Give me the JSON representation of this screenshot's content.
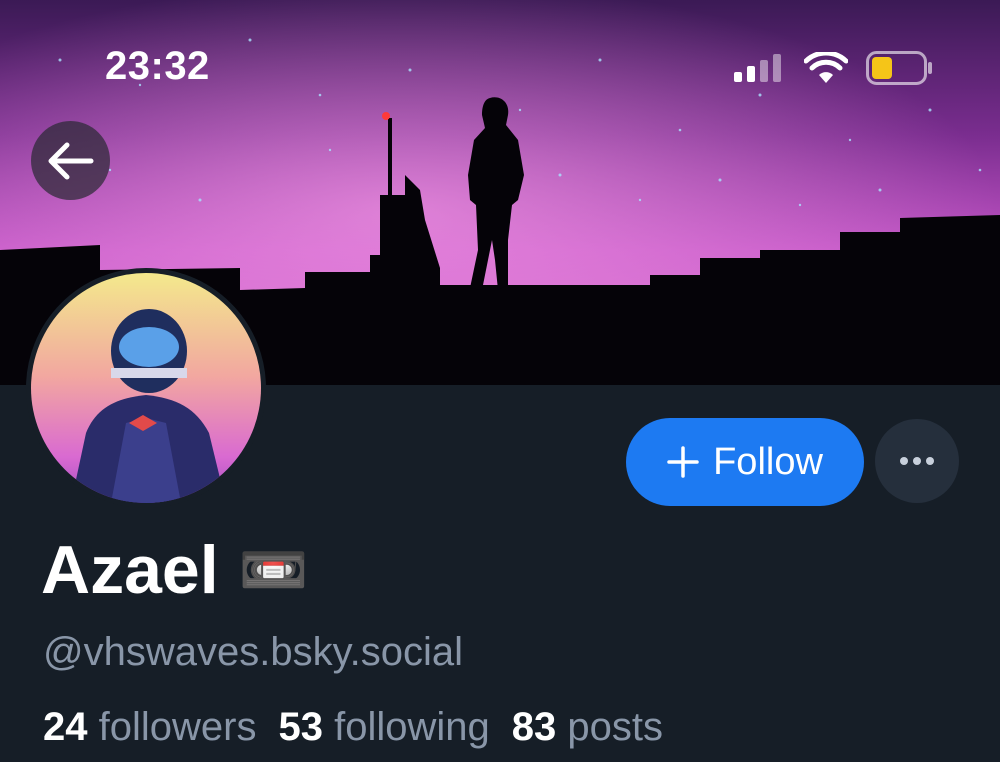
{
  "status_bar": {
    "time": "23:32",
    "icons": [
      "cellular-signal-icon",
      "wifi-icon",
      "battery-icon"
    ]
  },
  "banner": {
    "description_icon": "synthwave-city-banner"
  },
  "back_button": {
    "icon": "arrow-left-icon"
  },
  "profile": {
    "display_name": "Azael",
    "name_emoji": "📼",
    "handle": "@vhswaves.bsky.social",
    "followers_count": "24",
    "followers_label": "followers",
    "following_count": "53",
    "following_label": "following",
    "posts_count": "83",
    "posts_label": "posts"
  },
  "actions": {
    "follow_label": "Follow",
    "follow_icon": "plus-icon",
    "more_icon": "ellipsis-icon"
  },
  "colors": {
    "background": "#161e27",
    "accent": "#1d7af2",
    "muted_text": "#8996a8",
    "battery": "#f5c518"
  }
}
